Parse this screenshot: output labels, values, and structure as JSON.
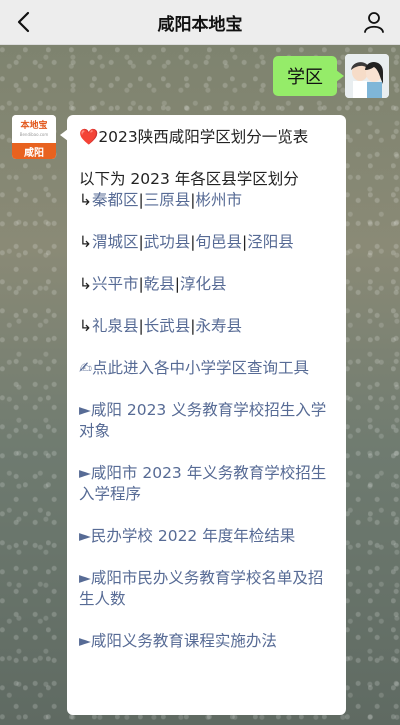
{
  "header": {
    "title": "咸阳本地宝"
  },
  "chat": {
    "outgoing": {
      "text": "学区"
    },
    "incoming": {
      "avatar_name": "本地宝",
      "avatar_web": "Bendibao.com",
      "avatar_city": "咸阳",
      "heart": "❤️",
      "headline": "2023陕西咸阳学区划分一览表",
      "intro": "以下为 2023 年各区县学区划分",
      "bullet": "↳",
      "sep": "|",
      "groups": [
        [
          "秦都区",
          "三原县",
          "彬州市"
        ],
        [
          "渭城区",
          "武功县",
          "旬邑县",
          "泾阳县"
        ],
        [
          "兴平市",
          "乾县",
          "淳化县"
        ],
        [
          "礼泉县",
          "长武县",
          "永寿县"
        ]
      ],
      "query_tool": "✍点此进入各中小学学区查询工具",
      "links": [
        "►咸阳 2023 义务教育学校招生入学对象",
        "►咸阳市 2023 年义务教育学校招生入学程序",
        "►民办学校 2022 年度年检结果",
        "►咸阳市民办义务教育学校名单及招生人数",
        "►咸阳义务教育课程实施办法"
      ]
    }
  }
}
